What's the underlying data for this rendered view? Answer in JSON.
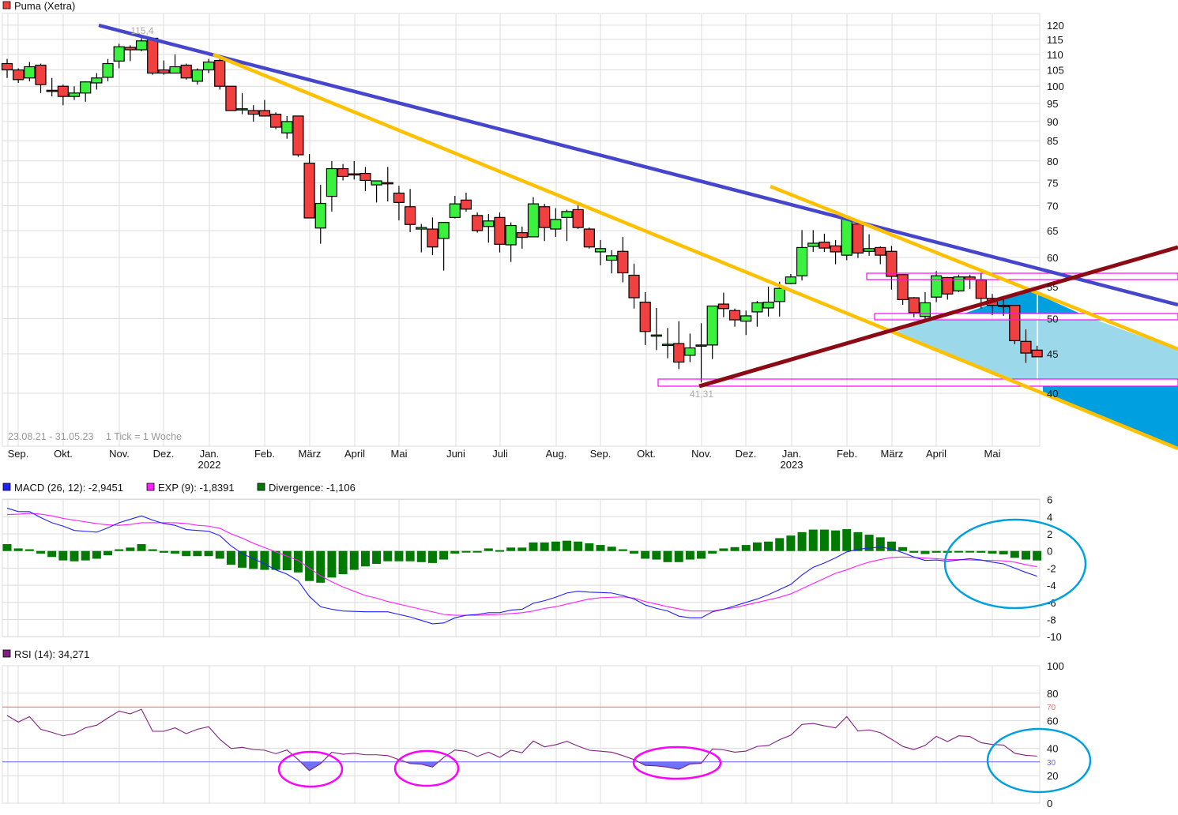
{
  "title": "Puma (Xetra)",
  "colors": {
    "up": "#3cf040",
    "down": "#f04040",
    "grid": "#dcdcdc",
    "macd": "#2020ff",
    "exp": "#ff20ff",
    "divergence": "#007a00",
    "rsi": "#802080",
    "trend_blue": "#4646cc",
    "trend_yellow": "#ffc000",
    "trend_darkred": "#8b0a14",
    "zone_magenta": "#ff00ff",
    "fill_dark": "#00a0e0",
    "fill_light": "#9bd8ea",
    "circle_cyan": "#00a0e0",
    "rsi_oversold_fill": "#7070ff"
  },
  "footer": {
    "range": "23.08.21 - 31.05.23",
    "tick": "1 Tick = 1 Woche"
  },
  "annotations": {
    "high": "115,4",
    "low": "41,31"
  },
  "x_axis": {
    "months": [
      "Sep.",
      "Okt.",
      "Nov.",
      "Dez.",
      "Jan.",
      "Feb.",
      "März",
      "April",
      "Mai",
      "Juni",
      "Juli",
      "Aug.",
      "Sep.",
      "Okt.",
      "Nov.",
      "Dez.",
      "Jan.",
      "Feb.",
      "März",
      "April",
      "Mai"
    ],
    "years": [
      "2022",
      "2023"
    ]
  },
  "macd_legend": {
    "macd": "MACD (26, 12): -2,9451",
    "exp": "EXP (9): -1,8391",
    "divergence": "Divergence: -1,106"
  },
  "rsi_legend": {
    "rsi": "RSI (14): 34,271"
  },
  "chart_data": [
    {
      "type": "candlestick",
      "name": "Puma (Xetra)",
      "interval": "1 Woche",
      "y_scale": "log",
      "ylim": [
        40,
        120
      ],
      "y_ticks": [
        "120",
        "115",
        "110",
        "105",
        "100",
        "95",
        "90",
        "85",
        "80",
        "75",
        "70",
        "65",
        "60",
        "55",
        "50",
        "45",
        "40"
      ],
      "grid": true,
      "ohlc": [
        [
          107,
          108.5,
          102.5,
          105
        ],
        [
          105,
          105.5,
          101,
          102
        ],
        [
          102.5,
          107.5,
          101.5,
          106
        ],
        [
          106.5,
          107,
          98,
          100.5
        ],
        [
          98.8,
          102.5,
          97,
          98.5
        ],
        [
          100,
          100.5,
          94.5,
          97
        ],
        [
          97,
          100,
          96,
          98
        ],
        [
          98,
          101.5,
          95.5,
          101.3
        ],
        [
          101,
          104,
          99,
          102.5
        ],
        [
          102.7,
          108.5,
          101.5,
          107
        ],
        [
          107.8,
          113.5,
          105.5,
          112.5
        ],
        [
          112.3,
          113,
          107.8,
          111.5
        ],
        [
          111.5,
          115.4,
          111,
          114.5
        ],
        [
          115.4,
          115.4,
          103.5,
          104
        ],
        [
          105,
          108,
          103.5,
          104
        ],
        [
          104,
          110,
          104,
          106
        ],
        [
          106.5,
          107,
          102,
          102.5
        ],
        [
          101.5,
          105.5,
          100.5,
          105
        ],
        [
          105,
          108.5,
          104,
          107.5
        ],
        [
          108,
          109.5,
          99,
          100
        ],
        [
          100,
          100,
          93,
          93
        ],
        [
          93.5,
          98,
          92,
          93.5
        ],
        [
          93,
          94.5,
          90,
          92
        ],
        [
          93,
          96,
          91.5,
          91.5
        ],
        [
          92,
          92.5,
          88,
          88.5
        ],
        [
          87,
          91.5,
          85.5,
          90
        ],
        [
          91.5,
          91.5,
          81,
          81.5
        ],
        [
          79.5,
          81.7,
          67.5,
          67.5
        ],
        [
          65.5,
          74.5,
          62.5,
          70.5
        ],
        [
          72,
          80,
          68.8,
          78.2
        ],
        [
          78.2,
          79.3,
          75.5,
          76.4
        ],
        [
          77,
          80,
          75.7,
          76.8
        ],
        [
          77.1,
          78.6,
          73.1,
          75.5
        ],
        [
          74.5,
          75.5,
          70.7,
          75.4
        ],
        [
          75,
          78.6,
          70.9,
          74.9
        ],
        [
          72.7,
          74.3,
          67,
          70.7
        ],
        [
          69.8,
          73.6,
          64.7,
          66.2
        ],
        [
          65.3,
          66.3,
          60.9,
          65.6
        ],
        [
          65.3,
          67.6,
          60.4,
          61.9
        ],
        [
          63.5,
          66.6,
          57.7,
          66.6
        ],
        [
          67.6,
          72.1,
          67.4,
          70.4
        ],
        [
          71.2,
          72.8,
          68.8,
          69.3
        ],
        [
          68,
          68.6,
          64.6,
          65
        ],
        [
          65.8,
          68.3,
          62.7,
          66.9
        ],
        [
          67.6,
          68.6,
          60.9,
          62.4
        ],
        [
          62.3,
          66.6,
          59.2,
          66
        ],
        [
          64.6,
          65.8,
          61.6,
          63.7
        ],
        [
          63.8,
          71.8,
          63.8,
          70.4
        ],
        [
          69.8,
          70.4,
          63,
          65.6
        ],
        [
          65.3,
          69.5,
          63.8,
          67.2
        ],
        [
          67.6,
          69.2,
          63,
          68.8
        ],
        [
          69.2,
          70.2,
          65.3,
          65.6
        ],
        [
          65.3,
          65.6,
          61.6,
          61.9
        ],
        [
          61,
          63.2,
          58.6,
          61.6
        ],
        [
          59.5,
          61.3,
          57.2,
          60.3
        ],
        [
          61.1,
          63.8,
          55.7,
          57.3
        ],
        [
          56.9,
          58.9,
          51.5,
          53.2
        ],
        [
          52.5,
          54.1,
          46.2,
          48.1
        ],
        [
          47.5,
          51.6,
          45.5,
          47.6
        ],
        [
          46.3,
          48.6,
          44.4,
          46.3
        ],
        [
          46.4,
          49.6,
          43,
          43.9
        ],
        [
          44.8,
          47.8,
          43.9,
          45.8
        ],
        [
          46.2,
          49.3,
          41.31,
          46.1
        ],
        [
          46.2,
          51.9,
          44.3,
          51.9
        ],
        [
          52.2,
          54,
          50.2,
          51.5
        ],
        [
          51.2,
          51.5,
          48.8,
          49.8
        ],
        [
          49.6,
          51.2,
          47.6,
          50.4
        ],
        [
          51,
          52.7,
          48.8,
          52.4
        ],
        [
          51.6,
          55,
          50.3,
          52.5
        ],
        [
          52.6,
          55.8,
          50.3,
          54.7
        ],
        [
          55.5,
          57.1,
          55.4,
          56.6
        ],
        [
          56.8,
          65.1,
          56,
          61.8
        ],
        [
          62,
          65.1,
          61,
          62.6
        ],
        [
          62.8,
          64.4,
          61,
          61.7
        ],
        [
          62.1,
          63.2,
          58.8,
          61
        ],
        [
          60.4,
          67.4,
          59.5,
          67.4
        ],
        [
          66.3,
          66.4,
          59.9,
          60.8
        ],
        [
          61.1,
          64.3,
          60.3,
          61.6
        ],
        [
          61.8,
          62,
          58.8,
          60.4
        ],
        [
          61.1,
          62.1,
          54.5,
          56.7
        ],
        [
          57,
          57,
          52.1,
          52.9
        ],
        [
          53.2,
          53.3,
          50.2,
          50.9
        ],
        [
          50.3,
          54.1,
          50,
          52.4
        ],
        [
          53.3,
          57.6,
          52.5,
          56.8
        ],
        [
          56.5,
          56.6,
          52.9,
          53.8
        ],
        [
          54.3,
          57,
          54.1,
          56.6
        ],
        [
          56.6,
          57,
          54.6,
          56.2
        ],
        [
          56.1,
          57.3,
          51.5,
          53.1
        ],
        [
          53.1,
          53.8,
          50.5,
          52
        ],
        [
          52,
          53.3,
          50.4,
          51.8
        ],
        [
          52,
          52,
          46.3,
          46.8
        ],
        [
          46.7,
          48.4,
          43.8,
          45.1
        ],
        [
          45.5,
          46.1,
          44.6,
          44.6
        ]
      ]
    },
    {
      "type": "bar+line",
      "name": "MACD",
      "ylim": [
        -10,
        6
      ],
      "y_ticks": [
        "6",
        "4",
        "2",
        "0",
        "-2",
        "-4",
        "-6",
        "-8",
        "-10"
      ],
      "series": [
        {
          "name": "MACD (26, 12)",
          "type": "line",
          "values": [
            5.0,
            4.6,
            4.6,
            3.9,
            3.3,
            2.9,
            2.4,
            2.3,
            2.2,
            2.7,
            3.3,
            3.7,
            4.1,
            3.6,
            3.2,
            3.0,
            2.5,
            2.4,
            2.3,
            1.8,
            0.6,
            -0.3,
            -0.9,
            -1.5,
            -2.2,
            -2.7,
            -3.5,
            -5.3,
            -6.5,
            -6.8,
            -7.0,
            -7.05,
            -7.1,
            -7.1,
            -7.1,
            -7.4,
            -7.7,
            -8.1,
            -8.5,
            -8.4,
            -7.8,
            -7.5,
            -7.4,
            -7.2,
            -7.2,
            -6.9,
            -6.8,
            -6.1,
            -5.8,
            -5.4,
            -4.9,
            -4.7,
            -4.8,
            -4.85,
            -4.9,
            -5.2,
            -5.6,
            -6.3,
            -6.7,
            -7.0,
            -7.6,
            -7.8,
            -7.8,
            -7.1,
            -6.8,
            -6.4,
            -6.0,
            -5.6,
            -5.1,
            -4.5,
            -3.9,
            -2.8,
            -1.9,
            -1.4,
            -0.8,
            -0.1,
            0.2,
            0.35,
            0.45,
            0.25,
            -0.2,
            -0.7,
            -1.1,
            -1.05,
            -1.2,
            -1.05,
            -0.9,
            -1.05,
            -1.3,
            -1.5,
            -2.0,
            -2.5,
            -2.9451
          ]
        },
        {
          "name": "EXP (9)",
          "type": "line",
          "values": [
            4.25,
            4.3,
            4.4,
            4.3,
            4.1,
            3.8,
            3.6,
            3.4,
            3.2,
            3.05,
            3.0,
            3.1,
            3.3,
            3.3,
            3.3,
            3.3,
            3.2,
            3.0,
            2.9,
            2.65,
            2.0,
            1.5,
            0.9,
            0.4,
            -0.1,
            -0.6,
            -1.1,
            -2.0,
            -2.9,
            -3.6,
            -4.2,
            -4.7,
            -5.2,
            -5.5,
            -5.9,
            -6.2,
            -6.5,
            -6.8,
            -7.1,
            -7.4,
            -7.5,
            -7.5,
            -7.5,
            -7.45,
            -7.4,
            -7.3,
            -7.2,
            -7.0,
            -6.7,
            -6.5,
            -6.2,
            -5.9,
            -5.6,
            -5.45,
            -5.4,
            -5.35,
            -5.5,
            -5.9,
            -6.2,
            -6.5,
            -6.75,
            -7.0,
            -7.0,
            -7.0,
            -6.8,
            -6.6,
            -6.3,
            -6.0,
            -5.7,
            -5.4,
            -5.0,
            -4.4,
            -3.8,
            -3.2,
            -2.6,
            -2.2,
            -1.7,
            -1.3,
            -1.0,
            -0.75,
            -0.7,
            -0.75,
            -0.83,
            -0.9,
            -1.0,
            -1.0,
            -1.05,
            -1.1,
            -1.1,
            -1.15,
            -1.3,
            -1.6,
            -1.8391
          ]
        },
        {
          "name": "Divergence",
          "type": "bar",
          "values": [
            0.8,
            0.3,
            0.2,
            -0.3,
            -0.7,
            -1.1,
            -1.2,
            -1.1,
            -0.9,
            -0.5,
            0.2,
            0.4,
            0.8,
            0.2,
            -0.2,
            -0.3,
            -0.6,
            -0.6,
            -0.6,
            -0.9,
            -1.6,
            -1.95,
            -2.1,
            -2.2,
            -2.2,
            -2.25,
            -2.5,
            -3.5,
            -3.7,
            -3.1,
            -2.7,
            -2.2,
            -1.8,
            -1.5,
            -1.2,
            -1.2,
            -1.2,
            -1.3,
            -1.4,
            -1.0,
            -0.3,
            -0.05,
            -0.05,
            0.3,
            0.1,
            0.4,
            0.4,
            1.0,
            1.0,
            1.1,
            1.2,
            1.1,
            0.9,
            0.7,
            0.5,
            0.2,
            -0.3,
            -0.9,
            -1.0,
            -1.3,
            -1.3,
            -1.0,
            -0.9,
            -0.3,
            0.3,
            0.45,
            0.7,
            1.0,
            1.1,
            1.5,
            1.8,
            2.2,
            2.5,
            2.5,
            2.4,
            2.55,
            2.2,
            1.9,
            1.6,
            1.1,
            0.45,
            -0.2,
            -0.35,
            -0.2,
            -0.2,
            -0.1,
            -0.05,
            -0.2,
            -0.3,
            -0.4,
            -0.8,
            -1.0,
            -1.106
          ]
        }
      ]
    },
    {
      "type": "line",
      "name": "RSI (14)",
      "ylim": [
        0,
        100
      ],
      "y_ticks": [
        "100",
        "80",
        "60",
        "40",
        "20",
        "0"
      ],
      "levels": [
        {
          "value": "70",
          "color": "#ff6060"
        },
        {
          "value": "30",
          "color": "#6060ff"
        }
      ],
      "values": [
        63.8,
        59,
        63,
        53.8,
        51.5,
        49,
        50.6,
        54.8,
        56.7,
        62,
        67,
        65,
        68.3,
        52.3,
        52.3,
        54.8,
        50.6,
        53.8,
        55.6,
        46.5,
        39.8,
        40.6,
        39,
        38.5,
        36,
        38.7,
        31.7,
        23.7,
        28.8,
        37,
        35.6,
        36.3,
        35.2,
        35.2,
        34.6,
        31.7,
        28.8,
        28.3,
        26.3,
        33.3,
        38.7,
        37.7,
        34,
        37.1,
        33.3,
        38.5,
        36.7,
        45.2,
        41,
        42.5,
        45,
        41.5,
        38.5,
        37.8,
        37.1,
        34.6,
        31.7,
        27.5,
        27.1,
        26.2,
        24.6,
        28.5,
        29,
        39.4,
        38.8,
        37.1,
        37.9,
        41.3,
        41.9,
        46.2,
        49.4,
        57.3,
        58,
        56.3,
        54.8,
        63,
        52.5,
        53.3,
        51.3,
        46.5,
        41.3,
        39,
        42,
        48.6,
        44.8,
        49,
        48.5,
        44,
        42.7,
        42.3,
        36.3,
        34.8,
        34.271
      ]
    }
  ]
}
